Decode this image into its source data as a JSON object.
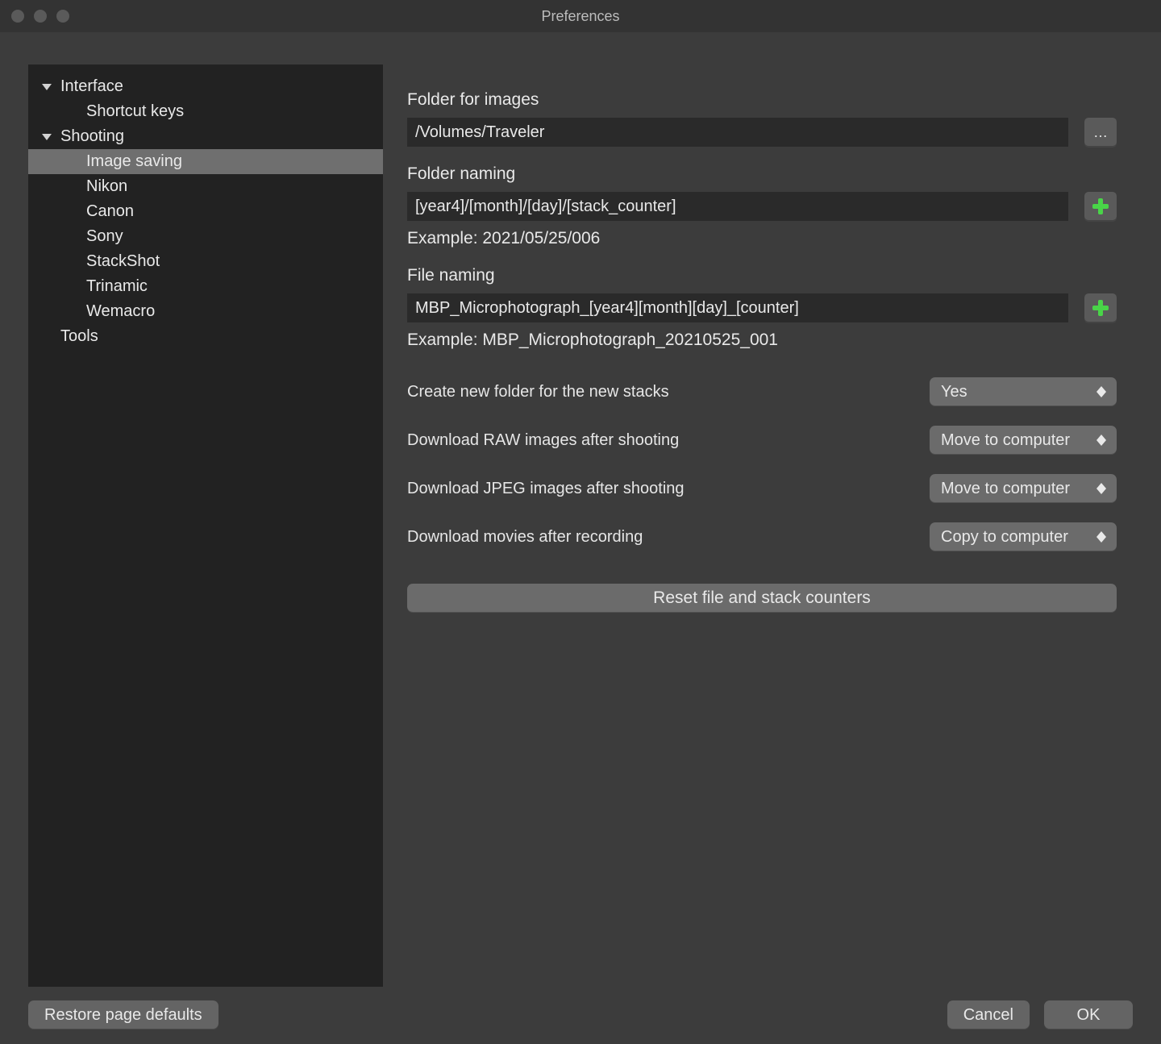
{
  "window": {
    "title": "Preferences"
  },
  "sidebar": {
    "items": [
      {
        "label": "Interface",
        "level": 1,
        "expanded": true
      },
      {
        "label": "Shortcut keys",
        "level": 2
      },
      {
        "label": "Shooting",
        "level": 1,
        "expanded": true
      },
      {
        "label": "Image saving",
        "level": 2,
        "selected": true
      },
      {
        "label": "Nikon",
        "level": 2
      },
      {
        "label": "Canon",
        "level": 2
      },
      {
        "label": "Sony",
        "level": 2
      },
      {
        "label": "StackShot",
        "level": 2
      },
      {
        "label": "Trinamic",
        "level": 2
      },
      {
        "label": "Wemacro",
        "level": 2
      },
      {
        "label": "Tools",
        "level": 1
      }
    ]
  },
  "panel": {
    "folder_for_images": {
      "label": "Folder for images",
      "value": "/Volumes/Traveler",
      "browse": "…"
    },
    "folder_naming": {
      "label": "Folder naming",
      "value": "[year4]/[month]/[day]/[stack_counter]",
      "example": "Example: 2021/05/25/006"
    },
    "file_naming": {
      "label": "File naming",
      "value": "MBP_Microphotograph_[year4][month][day]_[counter]",
      "example": "Example: MBP_Microphotograph_20210525_001"
    },
    "options": {
      "create_new_folder": {
        "label": "Create new folder for the new stacks",
        "value": "Yes"
      },
      "download_raw": {
        "label": "Download RAW images after shooting",
        "value": "Move to computer"
      },
      "download_jpeg": {
        "label": "Download JPEG images after shooting",
        "value": "Move to computer"
      },
      "download_movies": {
        "label": "Download movies after recording",
        "value": "Copy to computer"
      }
    },
    "reset_button": "Reset file and stack counters"
  },
  "footer": {
    "restore": "Restore page defaults",
    "cancel": "Cancel",
    "ok": "OK"
  }
}
